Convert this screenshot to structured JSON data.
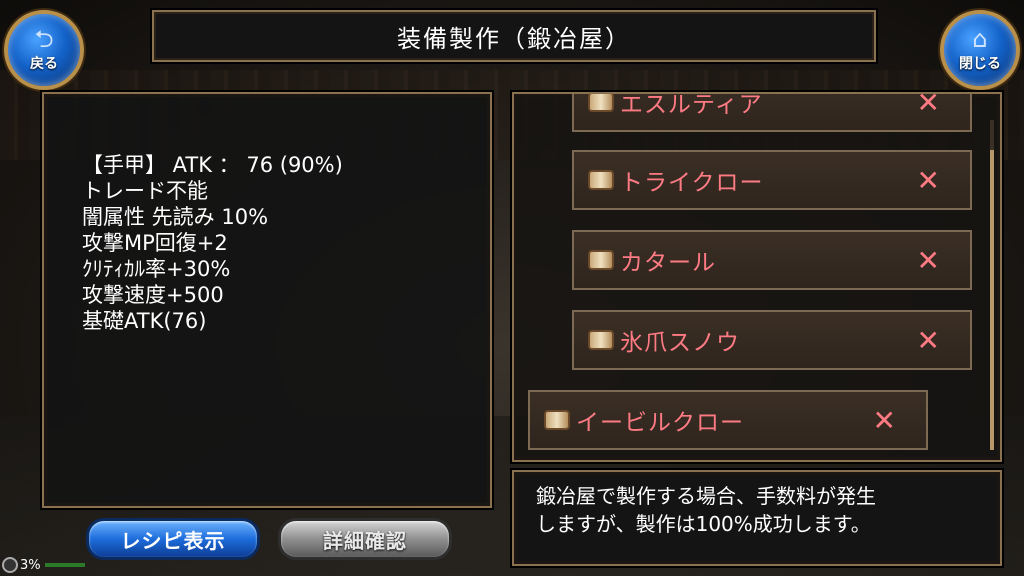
{
  "header": {
    "title": "装備製作（鍛冶屋）",
    "back_label": "戻る",
    "close_label": "閉じる"
  },
  "item_info": {
    "lines": [
      "【手甲】 ATK ： 76 (90%)",
      "トレード不能",
      "闇属性 先読み 10%",
      "攻撃MP回復+2",
      "ｸﾘﾃｨｶﾙ率+30%",
      "攻撃速度+500",
      "基礎ATK(76)"
    ]
  },
  "recipe_list": {
    "items": [
      {
        "name": "エスルティア",
        "mark": "✕"
      },
      {
        "name": "トライクロー",
        "mark": "✕"
      },
      {
        "name": "カタール",
        "mark": "✕"
      },
      {
        "name": "氷爪スノウ",
        "mark": "✕"
      },
      {
        "name": "イービルクロー",
        "mark": "✕"
      }
    ]
  },
  "message": {
    "lines": [
      "鍛冶屋で製作する場合、手数料が発生",
      "しますが、製作は100%成功します。"
    ]
  },
  "buttons": {
    "recipe_label": "レシピ表示",
    "detail_label": "詳細確認"
  },
  "status": {
    "percent": "3%"
  },
  "colors": {
    "item_text": "#ff7b84",
    "frame": "#8a7150",
    "button_blue": "#1d6ddc"
  }
}
